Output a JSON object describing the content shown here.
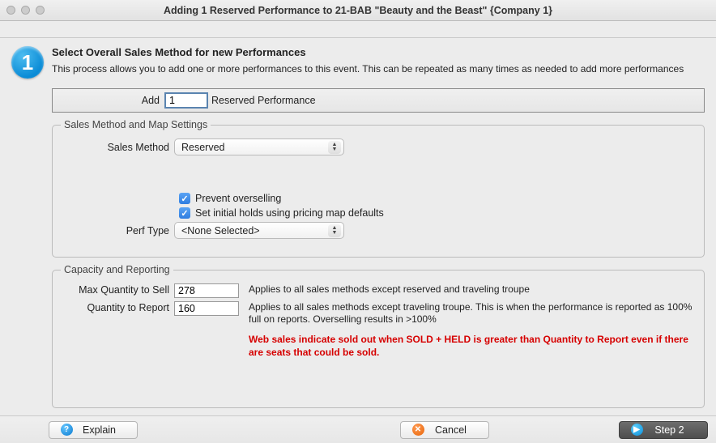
{
  "window": {
    "title": "Adding 1 Reserved Performance to 21-BAB \"Beauty and the Beast\" {Company 1}"
  },
  "step_badge": "1",
  "header": {
    "title": "Select Overall Sales Method for new Performances",
    "desc": "This process allows you to add one or more performances to this event.  This can be repeated as many times as needed to add more  performances"
  },
  "addbar": {
    "label": "Add",
    "value": "1",
    "suffix": "Reserved Performance"
  },
  "sales_group": {
    "legend": "Sales Method and Map Settings",
    "method_label": "Sales Method",
    "method_value": "Reserved",
    "prevent_label": "Prevent overselling",
    "setholds_label": "Set initial holds using pricing map defaults",
    "perftype_label": "Perf Type",
    "perftype_value": "<None Selected>"
  },
  "capacity_group": {
    "legend": "Capacity and Reporting",
    "max_label": "Max Quantity to Sell",
    "max_value": "278",
    "max_desc": "Applies to all sales methods except reserved and traveling troupe",
    "report_label": "Quantity to Report",
    "report_value": "160",
    "report_desc": "Applies to all sales methods except traveling troupe. This is when the performance is reported as 100% full on reports.  Overselling results in >100%",
    "warning": "Web sales indicate sold out when SOLD + HELD is greater than Quantity to Report even if there are seats that could be sold."
  },
  "footer": {
    "explain": "Explain",
    "cancel": "Cancel",
    "step2": "Step 2"
  }
}
